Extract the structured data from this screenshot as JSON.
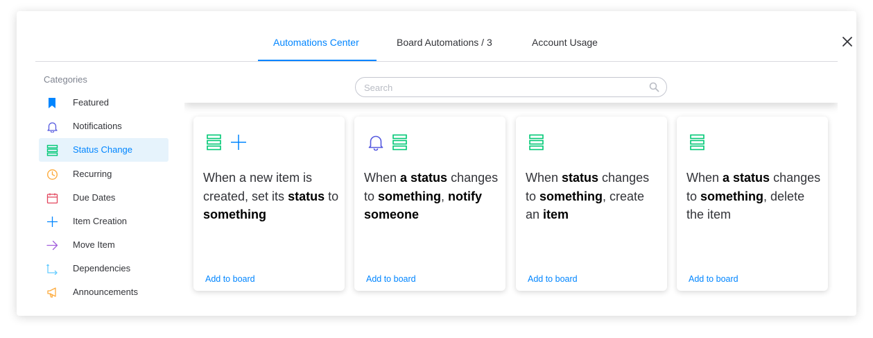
{
  "tabs": [
    {
      "label": "Automations Center",
      "active": true
    },
    {
      "label": "Board Automations / 3",
      "active": false
    },
    {
      "label": "Account Usage",
      "active": false
    }
  ],
  "close_icon": "close-x-icon",
  "sidebar": {
    "title": "Categories",
    "items": [
      {
        "label": "Featured",
        "icon": "bookmark-icon",
        "color": "#0085ff"
      },
      {
        "label": "Notifications",
        "icon": "bell-icon",
        "color": "#5559df"
      },
      {
        "label": "Status Change",
        "icon": "status-list-icon",
        "color": "#00c875",
        "active": true
      },
      {
        "label": "Recurring",
        "icon": "clock-icon",
        "color": "#fdab3d"
      },
      {
        "label": "Due Dates",
        "icon": "calendar-icon",
        "color": "#e2445c"
      },
      {
        "label": "Item Creation",
        "icon": "plus-icon",
        "color": "#0085ff"
      },
      {
        "label": "Move Item",
        "icon": "arrow-right-icon",
        "color": "#a25ddc"
      },
      {
        "label": "Dependencies",
        "icon": "dependency-icon",
        "color": "#66ccff"
      },
      {
        "label": "Announcements",
        "icon": "megaphone-icon",
        "color": "#fdab3d"
      }
    ]
  },
  "search": {
    "placeholder": "Search",
    "value": ""
  },
  "cards": [
    {
      "icons": [
        "status-list-icon",
        "plus-icon"
      ],
      "parts": [
        {
          "text": "When a new item is created, set its ",
          "bold": false
        },
        {
          "text": "status",
          "bold": true
        },
        {
          "text": " to ",
          "bold": false
        },
        {
          "text": "something",
          "bold": true
        }
      ],
      "action": "Add to board"
    },
    {
      "icons": [
        "bell-icon",
        "status-list-icon"
      ],
      "parts": [
        {
          "text": "When ",
          "bold": false
        },
        {
          "text": "a status",
          "bold": true
        },
        {
          "text": " changes to ",
          "bold": false
        },
        {
          "text": "something",
          "bold": true
        },
        {
          "text": ", ",
          "bold": false
        },
        {
          "text": "notify someone",
          "bold": true
        }
      ],
      "action": "Add to board"
    },
    {
      "icons": [
        "status-list-icon"
      ],
      "parts": [
        {
          "text": "When ",
          "bold": false
        },
        {
          "text": "status",
          "bold": true
        },
        {
          "text": " changes to ",
          "bold": false
        },
        {
          "text": "something",
          "bold": true
        },
        {
          "text": ", create an ",
          "bold": false
        },
        {
          "text": "item",
          "bold": true
        }
      ],
      "action": "Add to board"
    },
    {
      "icons": [
        "status-list-icon"
      ],
      "parts": [
        {
          "text": "When ",
          "bold": false
        },
        {
          "text": "a status",
          "bold": true
        },
        {
          "text": " changes to ",
          "bold": false
        },
        {
          "text": "something",
          "bold": true
        },
        {
          "text": ", delete the item",
          "bold": false
        }
      ],
      "action": "Add to board"
    }
  ],
  "colors": {
    "accent": "#0085ff",
    "status_green": "#00c875",
    "notify_purple": "#5559df"
  }
}
